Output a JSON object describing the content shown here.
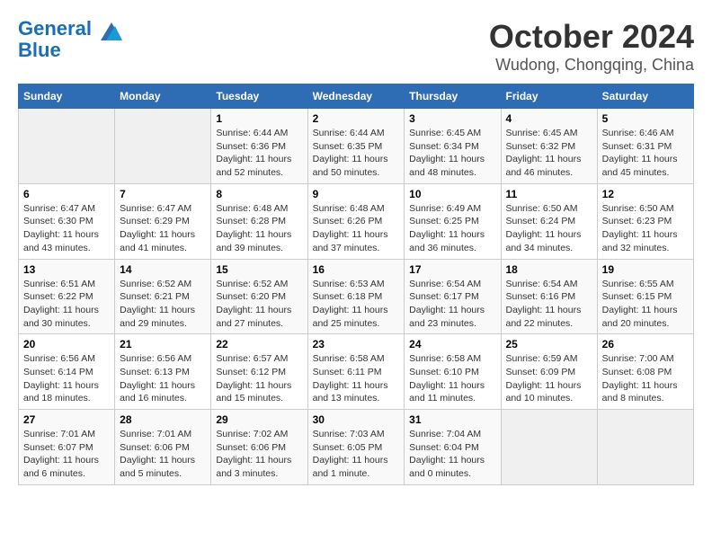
{
  "header": {
    "logo_line1": "General",
    "logo_line2": "Blue",
    "month": "October 2024",
    "location": "Wudong, Chongqing, China"
  },
  "days_of_week": [
    "Sunday",
    "Monday",
    "Tuesday",
    "Wednesday",
    "Thursday",
    "Friday",
    "Saturday"
  ],
  "weeks": [
    [
      {
        "day": "",
        "info": ""
      },
      {
        "day": "",
        "info": ""
      },
      {
        "day": "1",
        "info": "Sunrise: 6:44 AM\nSunset: 6:36 PM\nDaylight: 11 hours and 52 minutes."
      },
      {
        "day": "2",
        "info": "Sunrise: 6:44 AM\nSunset: 6:35 PM\nDaylight: 11 hours and 50 minutes."
      },
      {
        "day": "3",
        "info": "Sunrise: 6:45 AM\nSunset: 6:34 PM\nDaylight: 11 hours and 48 minutes."
      },
      {
        "day": "4",
        "info": "Sunrise: 6:45 AM\nSunset: 6:32 PM\nDaylight: 11 hours and 46 minutes."
      },
      {
        "day": "5",
        "info": "Sunrise: 6:46 AM\nSunset: 6:31 PM\nDaylight: 11 hours and 45 minutes."
      }
    ],
    [
      {
        "day": "6",
        "info": "Sunrise: 6:47 AM\nSunset: 6:30 PM\nDaylight: 11 hours and 43 minutes."
      },
      {
        "day": "7",
        "info": "Sunrise: 6:47 AM\nSunset: 6:29 PM\nDaylight: 11 hours and 41 minutes."
      },
      {
        "day": "8",
        "info": "Sunrise: 6:48 AM\nSunset: 6:28 PM\nDaylight: 11 hours and 39 minutes."
      },
      {
        "day": "9",
        "info": "Sunrise: 6:48 AM\nSunset: 6:26 PM\nDaylight: 11 hours and 37 minutes."
      },
      {
        "day": "10",
        "info": "Sunrise: 6:49 AM\nSunset: 6:25 PM\nDaylight: 11 hours and 36 minutes."
      },
      {
        "day": "11",
        "info": "Sunrise: 6:50 AM\nSunset: 6:24 PM\nDaylight: 11 hours and 34 minutes."
      },
      {
        "day": "12",
        "info": "Sunrise: 6:50 AM\nSunset: 6:23 PM\nDaylight: 11 hours and 32 minutes."
      }
    ],
    [
      {
        "day": "13",
        "info": "Sunrise: 6:51 AM\nSunset: 6:22 PM\nDaylight: 11 hours and 30 minutes."
      },
      {
        "day": "14",
        "info": "Sunrise: 6:52 AM\nSunset: 6:21 PM\nDaylight: 11 hours and 29 minutes."
      },
      {
        "day": "15",
        "info": "Sunrise: 6:52 AM\nSunset: 6:20 PM\nDaylight: 11 hours and 27 minutes."
      },
      {
        "day": "16",
        "info": "Sunrise: 6:53 AM\nSunset: 6:18 PM\nDaylight: 11 hours and 25 minutes."
      },
      {
        "day": "17",
        "info": "Sunrise: 6:54 AM\nSunset: 6:17 PM\nDaylight: 11 hours and 23 minutes."
      },
      {
        "day": "18",
        "info": "Sunrise: 6:54 AM\nSunset: 6:16 PM\nDaylight: 11 hours and 22 minutes."
      },
      {
        "day": "19",
        "info": "Sunrise: 6:55 AM\nSunset: 6:15 PM\nDaylight: 11 hours and 20 minutes."
      }
    ],
    [
      {
        "day": "20",
        "info": "Sunrise: 6:56 AM\nSunset: 6:14 PM\nDaylight: 11 hours and 18 minutes."
      },
      {
        "day": "21",
        "info": "Sunrise: 6:56 AM\nSunset: 6:13 PM\nDaylight: 11 hours and 16 minutes."
      },
      {
        "day": "22",
        "info": "Sunrise: 6:57 AM\nSunset: 6:12 PM\nDaylight: 11 hours and 15 minutes."
      },
      {
        "day": "23",
        "info": "Sunrise: 6:58 AM\nSunset: 6:11 PM\nDaylight: 11 hours and 13 minutes."
      },
      {
        "day": "24",
        "info": "Sunrise: 6:58 AM\nSunset: 6:10 PM\nDaylight: 11 hours and 11 minutes."
      },
      {
        "day": "25",
        "info": "Sunrise: 6:59 AM\nSunset: 6:09 PM\nDaylight: 11 hours and 10 minutes."
      },
      {
        "day": "26",
        "info": "Sunrise: 7:00 AM\nSunset: 6:08 PM\nDaylight: 11 hours and 8 minutes."
      }
    ],
    [
      {
        "day": "27",
        "info": "Sunrise: 7:01 AM\nSunset: 6:07 PM\nDaylight: 11 hours and 6 minutes."
      },
      {
        "day": "28",
        "info": "Sunrise: 7:01 AM\nSunset: 6:06 PM\nDaylight: 11 hours and 5 minutes."
      },
      {
        "day": "29",
        "info": "Sunrise: 7:02 AM\nSunset: 6:06 PM\nDaylight: 11 hours and 3 minutes."
      },
      {
        "day": "30",
        "info": "Sunrise: 7:03 AM\nSunset: 6:05 PM\nDaylight: 11 hours and 1 minute."
      },
      {
        "day": "31",
        "info": "Sunrise: 7:04 AM\nSunset: 6:04 PM\nDaylight: 11 hours and 0 minutes."
      },
      {
        "day": "",
        "info": ""
      },
      {
        "day": "",
        "info": ""
      }
    ]
  ]
}
